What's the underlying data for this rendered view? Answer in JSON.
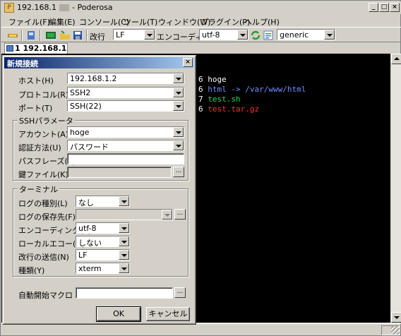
{
  "window": {
    "title_ip": "192.168.1",
    "title_app": "Poderosa",
    "controls": [
      "_",
      "□",
      "×"
    ]
  },
  "menu": [
    "ファイル(F)",
    "編集(E)",
    "コンソール(C)",
    "ツール(T)",
    "ウィンドウ(W)",
    "プラグイン(P)",
    "ヘルプ(H)"
  ],
  "toolbar": {
    "newline_label": "改行",
    "newline_value": "LF",
    "encoding_label": "エンコーディング",
    "encoding_value": "utf-8",
    "terminal_type_value": "generic"
  },
  "tab": {
    "label": "1 192.168.1"
  },
  "terminal": {
    "lines": [
      {
        "num": "6",
        "text": "hoge",
        "color": "#ffffff"
      },
      {
        "num": "6",
        "text": "html -> /var/www/html",
        "color": "#6f8fff"
      },
      {
        "num": "7",
        "text": "test.sh",
        "color": "#00e05a"
      },
      {
        "num": "6",
        "text": "test.tar.gz",
        "color": "#ff3030"
      }
    ],
    "left_fragments": [
      "[",
      "a",
      "l",
      "[",
      "[",
      "["
    ]
  },
  "dialog": {
    "title": "新規接続",
    "host_label": "ホスト(H)",
    "host_value": "192.168.1.2",
    "protocol_label": "プロトコル(R)",
    "protocol_value": "SSH2",
    "port_label": "ポート(T)",
    "port_value": "SSH(22)",
    "ssh_group": {
      "title": "SSHパラメータ",
      "account_label": "アカウント(A)",
      "account_value": "hoge",
      "auth_label": "認証方法(U)",
      "auth_value": "パスワード",
      "passphrase_label": "パスフレーズ(P)",
      "keyfile_label": "鍵ファイル(K)"
    },
    "terminal_group": {
      "title": "ターミナル",
      "log_type_label": "ログの種別(L)",
      "log_type_value": "なし",
      "log_path_label": "ログの保存先(F)",
      "encoding_label": "エンコーディング(E)",
      "encoding_value": "utf-8",
      "local_echo_label": "ローカルエコー(O)",
      "local_echo_value": "しない",
      "newline_label": "改行の送信(N)",
      "newline_value": "LF",
      "type_label": "種類(Y)",
      "type_value": "xterm"
    },
    "macro_label": "自動開始マクロ",
    "ellipsis": "...",
    "ok_label": "OK",
    "cancel_label": "キャンセル"
  }
}
